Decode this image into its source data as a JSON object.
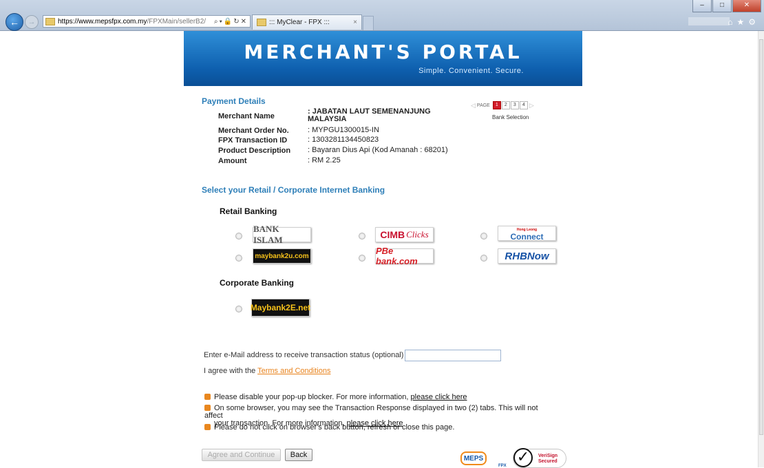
{
  "browser": {
    "address_host": "https://www.mepsfpx.com.my",
    "address_path": "/FPXMain/sellerB2/",
    "tab_title": "::: MyClear - FPX :::"
  },
  "banner": {
    "title": "MERCHANT'S PORTAL",
    "tagline": "Simple. Convenient. Secure."
  },
  "payment": {
    "heading": "Payment Details",
    "rows": [
      {
        "label": "Merchant Name",
        "value": ": JABATAN LAUT SEMENANJUNG MALAYSIA"
      },
      {
        "label": "Merchant Order No.",
        "value": ": MYPGU1300015-IN"
      },
      {
        "label": "FPX Transaction ID",
        "value": ": 1303281134450823"
      },
      {
        "label": "Product Description",
        "value": ": Bayaran Dius Api (Kod Amanah : 68201)"
      },
      {
        "label": "Amount",
        "value": ": RM 2.25"
      }
    ]
  },
  "pager": {
    "label": "PAGE",
    "pages": [
      "1",
      "2",
      "3",
      "4"
    ],
    "current": "1",
    "caption": "Bank Selection"
  },
  "select_heading": "Select your Retail / Corporate Internet Banking",
  "retail": {
    "heading": "Retail Banking",
    "banks": [
      {
        "name": "BANK ISLAM"
      },
      {
        "name": "CIMB",
        "suffix": "Clicks"
      },
      {
        "name": "Connect",
        "small": "Hong Leong"
      },
      {
        "name": "maybank2u.com"
      },
      {
        "name": "PBe bank.com"
      },
      {
        "name": "RHBNow"
      }
    ]
  },
  "corporate": {
    "heading": "Corporate Banking",
    "banks": [
      {
        "name": "Maybank2E.net"
      }
    ]
  },
  "email": {
    "label": "Enter e-Mail address to receive transaction status (optional)",
    "value": ""
  },
  "agree": {
    "prefix": "I agree with the ",
    "link": "Terms and Conditions"
  },
  "notes": {
    "n1_text": "Please disable your pop-up blocker. For more information, ",
    "n1_link": "please click here",
    "n2_text_a": "On some browser, you may see the Transaction Response displayed in two (2) tabs. This will not affect",
    "n2_text_b": "your transaction. For more information, ",
    "n2_link": "please click here",
    "n3_text": "Please do not click on browser's back button, refresh or close this page."
  },
  "buttons": {
    "agree": "Agree and Continue",
    "back": "Back"
  },
  "logos": {
    "meps": "MEPS",
    "fpx": "FPX",
    "verisign_1": "VeriSign",
    "verisign_2": "Secured"
  },
  "colors": {
    "banner_blue": "#0e5fae",
    "heading_blue": "#2e7fb8",
    "bullet_orange": "#e9871f",
    "link_orange": "#e8821b",
    "page_current": "#d21d2a"
  }
}
